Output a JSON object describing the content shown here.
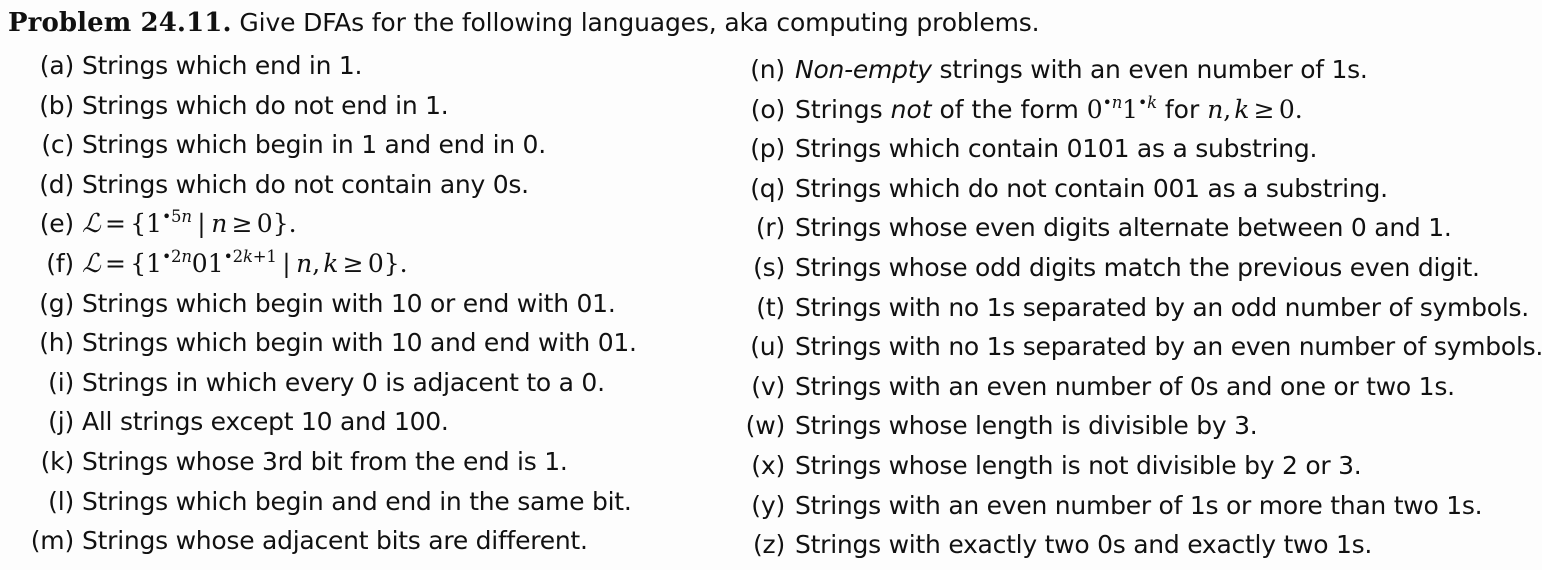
{
  "heading": {
    "problem_label": "Problem 24.11.",
    "problem_text": "Give DFAs for the following languages, aka computing problems."
  },
  "left_column": [
    {
      "label": "(a)",
      "text": "Strings which end in 1."
    },
    {
      "label": "(b)",
      "text": "Strings which do not end in 1."
    },
    {
      "label": "(c)",
      "text": "Strings which begin in 1 and end in 0."
    },
    {
      "label": "(d)",
      "text": "Strings which do not contain any 0s."
    },
    {
      "label": "(e)",
      "text": "ℒ = {1•⁵ⁿ | n ≥ 0}.",
      "math": "e"
    },
    {
      "label": "(f)",
      "text": "ℒ = {1•²ⁿ01•²ᵏ⁺¹ | n, k ≥ 0}.",
      "math": "f"
    },
    {
      "label": "(g)",
      "text": "Strings which begin with 10 or end with 01."
    },
    {
      "label": "(h)",
      "text": "Strings which begin with 10 and end with 01."
    },
    {
      "label": "(i)",
      "text": "Strings in which every 0 is adjacent to a 0."
    },
    {
      "label": "(j)",
      "text": "All strings except 10 and 100."
    },
    {
      "label": "(k)",
      "text": "Strings whose 3rd bit from the end is 1."
    },
    {
      "label": "(l)",
      "text": "Strings which begin and end in the same bit."
    },
    {
      "label": "(m)",
      "text": "Strings whose adjacent bits are different."
    }
  ],
  "right_column": [
    {
      "label": "(n)",
      "text": "Non-empty strings with an even number of 1s.",
      "italic_prefix": "Non-empty",
      "rest": " strings with an even number of 1s."
    },
    {
      "label": "(o)",
      "text": "Strings not of the form 0•ⁿ1•ᵏ for n, k ≥ 0.",
      "math": "o"
    },
    {
      "label": "(p)",
      "text": "Strings which contain 0101 as a substring."
    },
    {
      "label": "(q)",
      "text": "Strings which do not contain 001 as a substring."
    },
    {
      "label": "(r)",
      "text": "Strings whose even digits alternate between 0 and 1."
    },
    {
      "label": "(s)",
      "text": "Strings whose odd digits match the previous even digit."
    },
    {
      "label": "(t)",
      "text": "Strings with no 1s separated by an odd number of symbols."
    },
    {
      "label": "(u)",
      "text": "Strings with no 1s separated by an even number of symbols."
    },
    {
      "label": "(v)",
      "text": "Strings with an even number of 0s and one or two 1s."
    },
    {
      "label": "(w)",
      "text": "Strings whose length is divisible by 3."
    },
    {
      "label": "(x)",
      "text": "Strings whose length is not divisible by 2 or 3."
    },
    {
      "label": "(y)",
      "text": "Strings with an even number of 1s or more than two 1s."
    },
    {
      "label": "(z)",
      "text": "Strings with exactly two 0s and exactly two 1s."
    }
  ],
  "math_parts": {
    "e": {
      "cal_L": "ℒ",
      "equals": "=",
      "open_brace": "{",
      "base": "1",
      "sup_dot": "•",
      "sup_coef": "5",
      "sup_var": "n",
      "mid": "|",
      "var": "n",
      "geq": "≥",
      "zero": "0",
      "close_brace": "}",
      "period": "."
    },
    "f": {
      "cal_L": "ℒ",
      "equals": "=",
      "open_brace": "{",
      "base1": "1",
      "sup1_dot": "•",
      "sup1_coef": "2",
      "sup1_var": "n",
      "mid_digits": "01",
      "base2": "1",
      "sup2_dot": "•",
      "sup2_coef": "2",
      "sup2_var": "k",
      "sup2_plus": "+1",
      "mid": "|",
      "var1": "n",
      "comma": ",",
      "var2": "k",
      "geq": "≥",
      "zero": "0",
      "close_brace": "}",
      "period": "."
    },
    "o": {
      "prefix": "Strings ",
      "italic_not": "not",
      "mid_text": " of the form ",
      "base0": "0",
      "sup0_dot": "•",
      "sup0_var": "n",
      "base1": "1",
      "sup1_dot": "•",
      "sup1_var": "k",
      "for_text": " for ",
      "var1": "n",
      "comma": ",",
      "var2": "k",
      "geq": "≥",
      "zero": "0",
      "period": "."
    }
  },
  "colors": {
    "background": "#fdfdfd",
    "text": "#111111"
  }
}
